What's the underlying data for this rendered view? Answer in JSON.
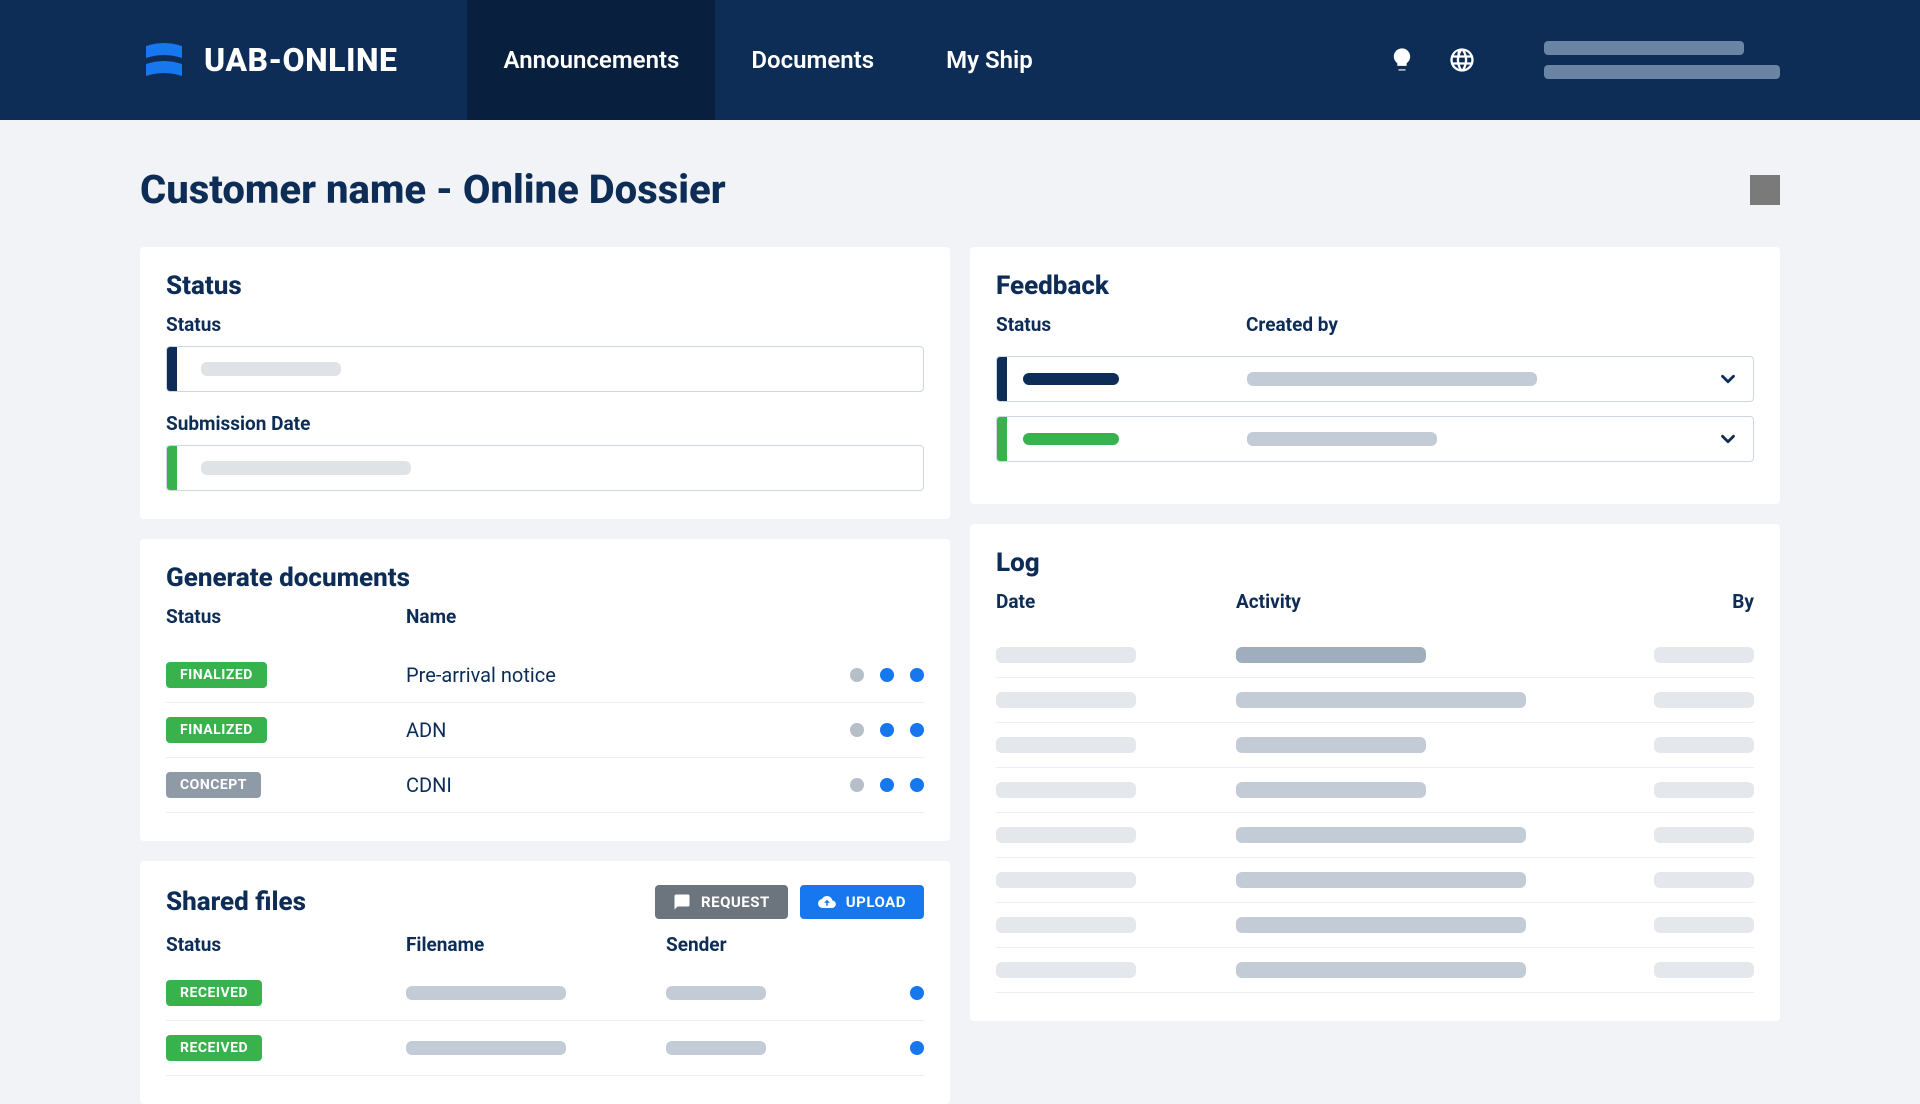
{
  "brand": "UAB-ONLINE",
  "nav": {
    "announcements": "Announcements",
    "documents": "Documents",
    "myship": "My Ship"
  },
  "page_title": "Customer name - Online Dossier",
  "status_card": {
    "title": "Status",
    "status_label": "Status",
    "submission_label": "Submission Date"
  },
  "generate_card": {
    "title": "Generate documents",
    "col_status": "Status",
    "col_name": "Name",
    "rows": [
      {
        "status": "FINALIZED",
        "badge_variant": "green",
        "name": "Pre-arrival notice"
      },
      {
        "status": "FINALIZED",
        "badge_variant": "green",
        "name": "ADN"
      },
      {
        "status": "CONCEPT",
        "badge_variant": "gray",
        "name": "CDNI"
      }
    ]
  },
  "shared_card": {
    "title": "Shared files",
    "request_label": "REQUEST",
    "upload_label": "UPLOAD",
    "col_status": "Status",
    "col_filename": "Filename",
    "col_sender": "Sender",
    "rows": [
      {
        "status": "RECEIVED"
      },
      {
        "status": "RECEIVED"
      }
    ]
  },
  "feedback_card": {
    "title": "Feedback",
    "col_status": "Status",
    "col_created": "Created by",
    "rows": [
      {
        "accent": "navy"
      },
      {
        "accent": "green"
      }
    ]
  },
  "log_card": {
    "title": "Log",
    "col_date": "Date",
    "col_activity": "Activity",
    "col_by": "By",
    "row_count": 8
  }
}
